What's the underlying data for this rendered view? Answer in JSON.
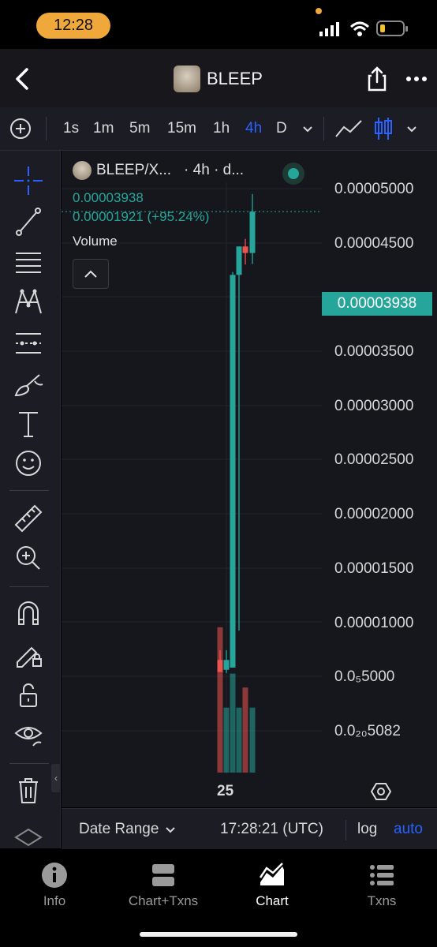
{
  "status_bar": {
    "time": "12:28"
  },
  "header": {
    "title": "BLEEP"
  },
  "toolbar": {
    "timeframes": [
      "1s",
      "1m",
      "5m",
      "15m",
      "1h",
      "4h",
      "D"
    ],
    "active_timeframe": "4h"
  },
  "legend": {
    "symbol": "BLEEP/X...",
    "interval": "· 4h · d...",
    "price": "0.00003938",
    "change": "0.00001921 (+95.24%)",
    "volume_label": "Volume"
  },
  "price_axis": {
    "labels": [
      "0.00005000",
      "0.00004500",
      "0.00003500",
      "0.00003000",
      "0.00002500",
      "0.00002000",
      "0.00001500",
      "0.00001000",
      "0.0₅5000",
      "0.0₂₀5082"
    ],
    "current_price": "0.00003938"
  },
  "time_axis": {
    "labels": [
      "25"
    ]
  },
  "bottom_bar": {
    "date_range": "Date Range",
    "clock": "17:28:21 (UTC)",
    "log": "log",
    "auto": "auto"
  },
  "tabs": [
    {
      "label": "Info",
      "icon": "info-icon"
    },
    {
      "label": "Chart+Txns",
      "icon": "chart-txns-icon"
    },
    {
      "label": "Chart",
      "icon": "chart-icon"
    },
    {
      "label": "Txns",
      "icon": "list-icon"
    }
  ],
  "colors": {
    "up": "#26a69a",
    "down": "#ef5350",
    "accent": "#2962ff",
    "status_pill": "#f0a83a"
  },
  "chart_data": {
    "type": "candlestick",
    "ylim": [
      0,
      5e-05
    ],
    "y_scale": "log",
    "candles": [
      {
        "open": 6.5e-06,
        "close": 5.4e-06,
        "high": 7.4e-06,
        "low": 5.8e-06,
        "direction": "down"
      },
      {
        "open": 5.6e-06,
        "close": 6.5e-06,
        "high": 7.4e-06,
        "low": 5.3e-06,
        "direction": "up"
      },
      {
        "open": 5.8e-06,
        "close": 1.02e-05,
        "high": 1.15e-05,
        "low": 6e-06,
        "direction": "up"
      },
      {
        "open": 1.02e-05,
        "close": 2.33e-05,
        "high": 2.33e-05,
        "low": 9.2e-06,
        "direction": "up"
      },
      {
        "open": 2.33e-05,
        "close": 2.03e-05,
        "high": 2.68e-05,
        "low": 1.5e-05,
        "direction": "down"
      },
      {
        "open": 2.03e-05,
        "close": 3.94e-05,
        "high": 4.75e-05,
        "low": 1.52e-05,
        "direction": "up"
      }
    ],
    "volume": [
      {
        "value": 0.94,
        "direction": "down"
      },
      {
        "value": 0.42,
        "direction": "up"
      },
      {
        "value": 0.64,
        "direction": "up"
      },
      {
        "value": 0.42,
        "direction": "up"
      },
      {
        "value": 0.55,
        "direction": "down"
      },
      {
        "value": 0.42,
        "direction": "up"
      }
    ]
  }
}
